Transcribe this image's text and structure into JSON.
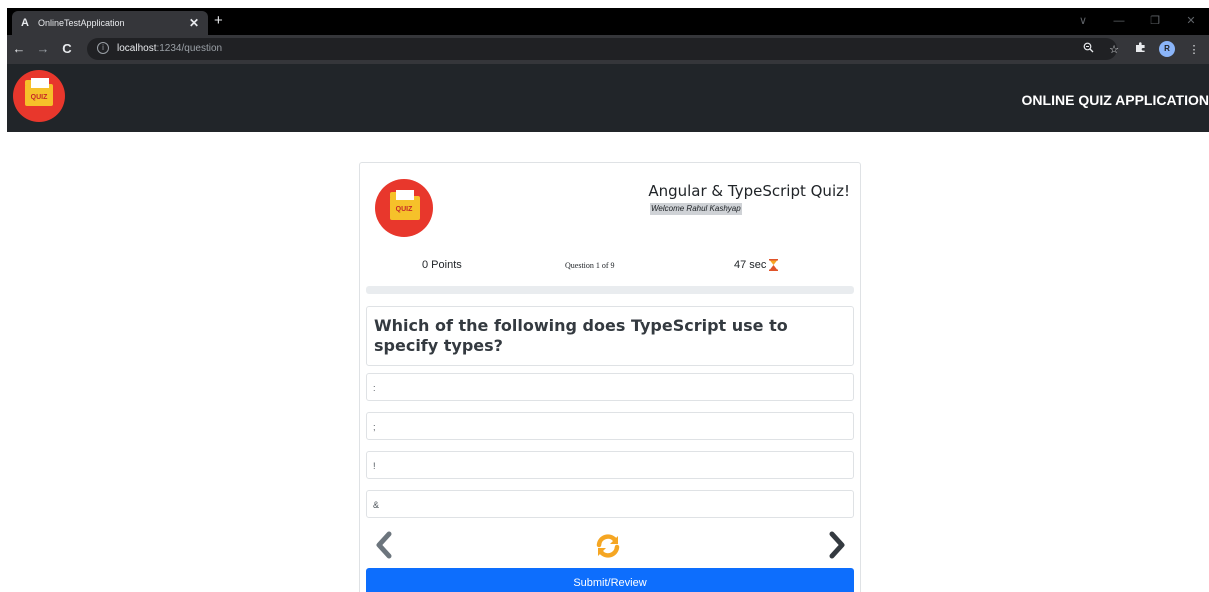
{
  "browser": {
    "tab_favicon": "A",
    "tab_title": "OnlineTestApplication",
    "tab_close": "✕",
    "new_tab": "+",
    "url_host": "localhost",
    "url_rest": ":1234/question",
    "avatar_letter": "R"
  },
  "navbar": {
    "logo_text": "QUIZ",
    "title": "ONLINE QUIZ APPLICATION"
  },
  "quiz": {
    "logo_text": "QUIZ",
    "title": "Angular & TypeScript Quiz!",
    "welcome": "Welcome Rahul Kashyap",
    "points": "0 Points",
    "question_count": "Question 1 of 9",
    "timer": "47 sec",
    "progress_fraction": 0,
    "question": "Which of the following does TypeScript use to specify types?",
    "options": [
      ":",
      ";",
      "!",
      "&"
    ],
    "submit_label": "Submit/Review"
  },
  "colors": {
    "navbar": "#212529",
    "logo_red": "#e8372c",
    "logo_yellow": "#f6c12a",
    "accent_blue": "#0d6efd",
    "refresh_orange": "#f5a623",
    "arrow_grey": "#6c757d",
    "hourglass": "#e0542a"
  },
  "icons": {
    "prev": "chevron-left-icon",
    "next": "chevron-right-icon",
    "refresh": "refresh-icon",
    "timer": "hourglass-icon"
  }
}
